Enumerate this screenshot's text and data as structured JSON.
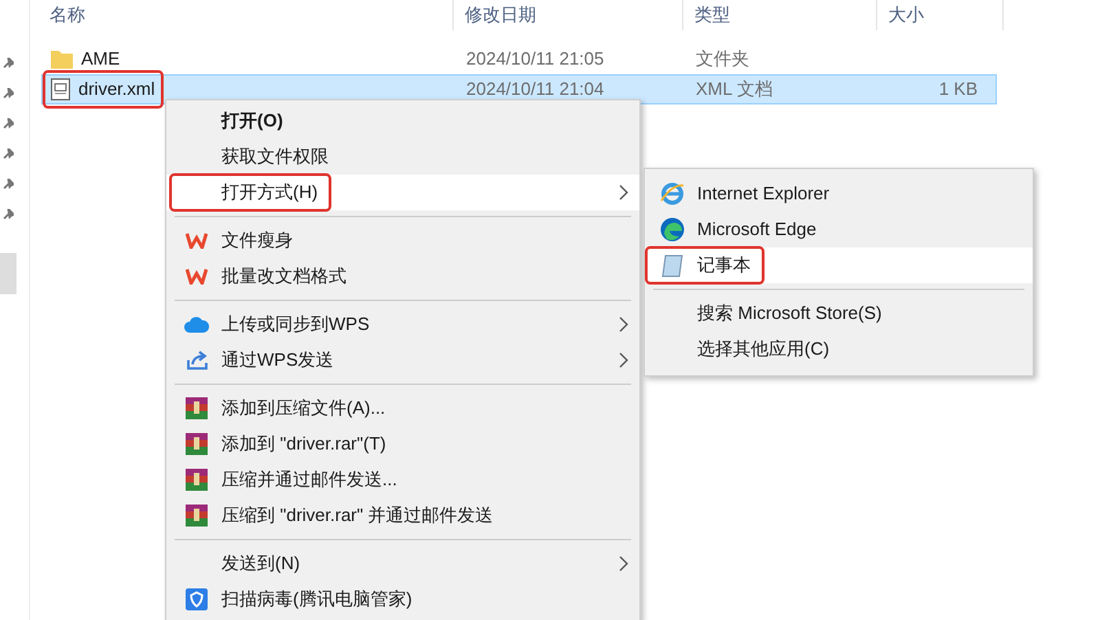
{
  "columns": [
    "名称",
    "修改日期",
    "类型",
    "大小"
  ],
  "files": [
    {
      "kind": "folder",
      "name": "AME",
      "modified": "2024/10/11 21:05",
      "type": "文件夹",
      "selected": false,
      "annotated": false
    },
    {
      "kind": "xml",
      "name": "driver.xml",
      "modified": "2024/10/11 21:04",
      "type": "XML 文档",
      "size": "1 KB",
      "selected": true,
      "annotated": true
    }
  ],
  "context_menu": {
    "groups": [
      [
        {
          "kind": "plain",
          "label": "打开(O)",
          "bold": true,
          "submenu": false,
          "selected": false,
          "annotated": false
        },
        {
          "kind": "plain",
          "label": "获取文件权限",
          "bold": false,
          "submenu": false,
          "selected": false,
          "annotated": false
        },
        {
          "kind": "plain",
          "label": "打开方式(H)",
          "bold": false,
          "submenu": true,
          "selected": true,
          "annotated": true
        }
      ],
      [
        {
          "kind": "wps",
          "label": "文件瘦身",
          "bold": false,
          "submenu": false,
          "selected": false,
          "annotated": false
        },
        {
          "kind": "wps",
          "label": "批量改文档格式",
          "bold": false,
          "submenu": false,
          "selected": false,
          "annotated": false
        }
      ],
      [
        {
          "kind": "cloud",
          "label": "上传或同步到WPS",
          "bold": false,
          "submenu": true,
          "selected": false,
          "annotated": false
        },
        {
          "kind": "share",
          "label": "通过WPS发送",
          "bold": false,
          "submenu": true,
          "selected": false,
          "annotated": false
        }
      ],
      [
        {
          "kind": "rar",
          "label": "添加到压缩文件(A)...",
          "bold": false,
          "submenu": false,
          "selected": false,
          "annotated": false
        },
        {
          "kind": "rar",
          "label": "添加到 \"driver.rar\"(T)",
          "bold": false,
          "submenu": false,
          "selected": false,
          "annotated": false
        },
        {
          "kind": "rar",
          "label": "压缩并通过邮件发送...",
          "bold": false,
          "submenu": false,
          "selected": false,
          "annotated": false
        },
        {
          "kind": "rar",
          "label": "压缩到 \"driver.rar\" 并通过邮件发送",
          "bold": false,
          "submenu": false,
          "selected": false,
          "annotated": false
        }
      ],
      [
        {
          "kind": "plain",
          "label": "发送到(N)",
          "bold": false,
          "submenu": true,
          "selected": false,
          "annotated": false
        },
        {
          "kind": "shield",
          "label": "扫描病毒(腾讯电脑管家)",
          "bold": false,
          "submenu": false,
          "selected": false,
          "annotated": false
        }
      ]
    ]
  },
  "open_with_menu": {
    "groups": [
      [
        {
          "kind": "ie",
          "label": "Internet Explorer",
          "selected": false,
          "annotated": false
        },
        {
          "kind": "edge",
          "label": "Microsoft Edge",
          "selected": false,
          "annotated": false
        },
        {
          "kind": "notepad",
          "label": "记事本",
          "selected": true,
          "annotated": true
        }
      ],
      [
        {
          "kind": "plain",
          "label": "搜索 Microsoft Store(S)",
          "selected": false,
          "annotated": false
        },
        {
          "kind": "plain",
          "label": "选择其他应用(C)",
          "selected": false,
          "annotated": false
        }
      ]
    ]
  }
}
